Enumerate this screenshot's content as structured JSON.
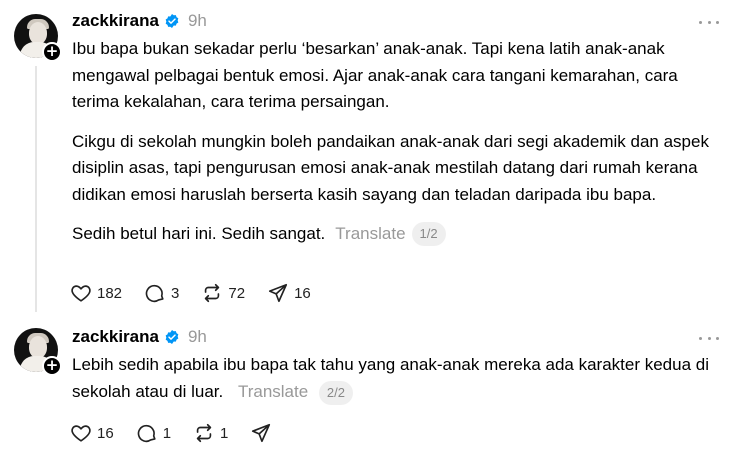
{
  "posts": [
    {
      "username": "zackkirana",
      "time": "9h",
      "paragraphs": [
        "Ibu bapa bukan sekadar perlu ‘besarkan’ anak-anak. Tapi kena latih anak-anak mengawal pelbagai bentuk emosi. Ajar anak-anak cara tangani kemarahan, cara terima kekalahan, cara terima persaingan.",
        "Cikgu di sekolah mungkin boleh pandaikan anak-anak dari segi akademik dan aspek disiplin asas, tapi pengurusan emosi anak-anak mestilah datang dari rumah kerana didikan emosi haruslah berserta kasih sayang dan teladan daripada ibu bapa.",
        "Sedih betul hari ini. Sedih sangat."
      ],
      "translate": "Translate",
      "pager": "1/2",
      "likes": "182",
      "replies": "3",
      "reposts": "72",
      "shares": "16"
    },
    {
      "username": "zackkirana",
      "time": "9h",
      "paragraphs": [
        "Lebih sedih apabila ibu bapa tak tahu yang anak-anak mereka ada karakter kedua di sekolah atau di luar."
      ],
      "translate": "Translate",
      "pager": "2/2",
      "likes": "16",
      "replies": "1",
      "reposts": "1",
      "shares": ""
    }
  ],
  "icons": {
    "verified": "verified-badge-icon",
    "like": "heart-icon",
    "reply": "comment-icon",
    "repost": "repost-icon",
    "share": "send-icon",
    "more": "more-dots-icon"
  },
  "colors": {
    "verified": "#0095f6",
    "muted": "#999999"
  }
}
